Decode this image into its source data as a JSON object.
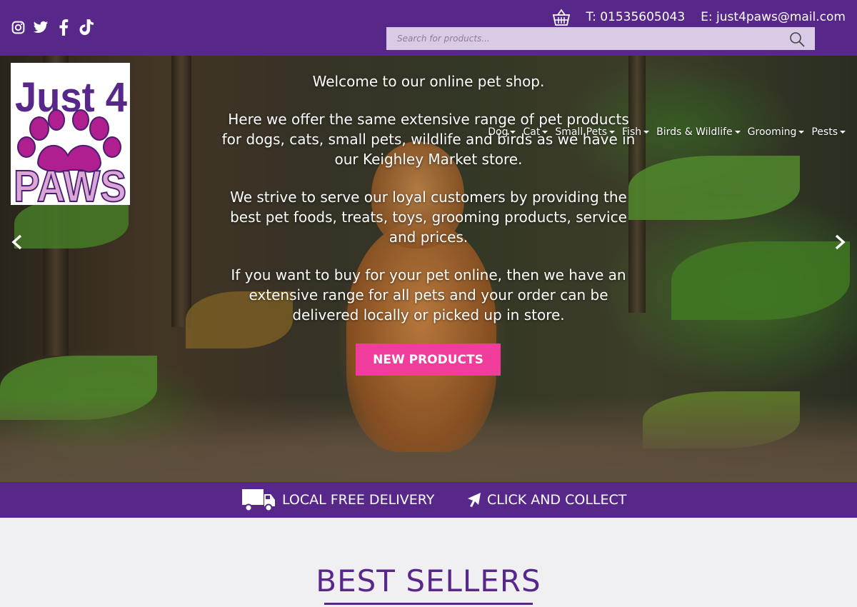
{
  "header": {
    "social": [
      {
        "name": "instagram-icon"
      },
      {
        "name": "twitter-icon"
      },
      {
        "name": "facebook-icon"
      },
      {
        "name": "tiktok-icon"
      }
    ],
    "phone": "T: 01535605043",
    "email": "E: just4paws@mail.com",
    "search_placeholder": "Search for products..."
  },
  "logo": {
    "line1": "Just 4",
    "line2": "PAWS"
  },
  "nav": {
    "items": [
      {
        "label": "Dog"
      },
      {
        "label": "Cat"
      },
      {
        "label": "Small Pets"
      },
      {
        "label": "Fish"
      },
      {
        "label": "Birds & Wildlife"
      },
      {
        "label": "Grooming"
      },
      {
        "label": "Pests"
      }
    ]
  },
  "hero": {
    "paragraphs": [
      "Welcome to our online pet shop.",
      "Here we offer the same extensive range of pet products for dogs, cats, small pets, wildlife and birds as we have in our Keighley Market store.",
      "We strive to serve our loyal customers by providing the best pet foods, treats, toys, grooming products, service and prices.",
      "If you want to buy for your pet online, then we have an extensive range for all pets and your order can be delivered locally or picked up in store."
    ],
    "cta": "NEW PRODUCTS"
  },
  "strip": {
    "delivery": "LOCAL FREE DELIVERY",
    "collect": "CLICK AND COLLECT"
  },
  "best_sellers": {
    "title": "BEST SELLERS"
  },
  "colors": {
    "brand_purple": "#57288a",
    "cta_pink": "#f03c9b",
    "logo_purple": "#57288a",
    "logo_magenta": "#b01f8f",
    "logo_lilac": "#d9a6d6"
  }
}
